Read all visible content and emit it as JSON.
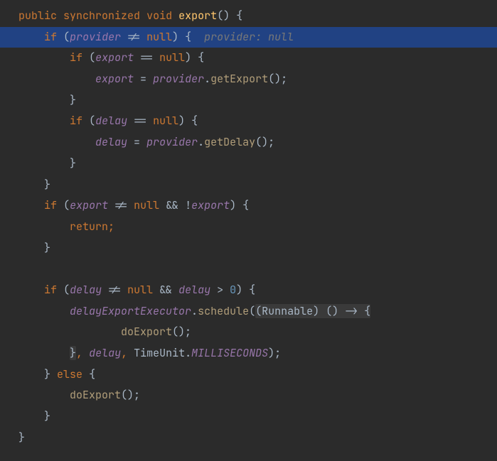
{
  "code": {
    "l1": {
      "kw1": "public",
      "kw2": "synchronized",
      "kw3": "void",
      "method": "export",
      "paren": "() {"
    },
    "l2": {
      "indent": "    ",
      "kw": "if",
      "p1": " (",
      "v": "provider",
      "op": " != ",
      "nul": "null",
      "p2": ") {  ",
      "hint": "provider: null"
    },
    "l3": {
      "indent": "        ",
      "kw": "if",
      "p1": " (",
      "v": "export",
      "op": " == ",
      "nul": "null",
      "p2": ") {"
    },
    "l4": {
      "indent": "            ",
      "v1": "export",
      "eq": " = ",
      "v2": "provider",
      "dot": ".",
      "m": "getExport",
      "p": "();"
    },
    "l5": {
      "indent": "        ",
      "b": "}"
    },
    "l6": {
      "indent": "        ",
      "kw": "if",
      "p1": " (",
      "v": "delay",
      "op": " == ",
      "nul": "null",
      "p2": ") {"
    },
    "l7": {
      "indent": "            ",
      "v1": "delay",
      "eq": " = ",
      "v2": "provider",
      "dot": ".",
      "m": "getDelay",
      "p": "();"
    },
    "l8": {
      "indent": "        ",
      "b": "}"
    },
    "l9": {
      "indent": "    ",
      "b": "}"
    },
    "l10": {
      "indent": "    ",
      "kw": "if",
      "p1": " (",
      "v1": "export",
      "op1": " != ",
      "nul": "null",
      "and": " && !",
      "v2": "export",
      "p2": ") {"
    },
    "l11": {
      "indent": "        ",
      "kw": "return",
      "semi": ";"
    },
    "l12": {
      "indent": "    ",
      "b": "}"
    },
    "l13": {
      "indent": ""
    },
    "l14": {
      "indent": "    ",
      "kw": "if",
      "p1": " (",
      "v1": "delay",
      "op1": " != ",
      "nul": "null",
      "and": " && ",
      "v2": "delay",
      "gt": " > ",
      "num": "0",
      "p2": ") {"
    },
    "l15": {
      "indent": "        ",
      "v": "delayExportExecutor",
      "dot": ".",
      "m": "schedule",
      "p1": "(",
      "cast": "(Runnable) () -> {"
    },
    "l16": {
      "indent": "                ",
      "m": "doExport",
      "p": "();"
    },
    "l17": {
      "indent": "        ",
      "b": "}",
      "comma": ", ",
      "v": "delay",
      "comma2": ", ",
      "type": "TimeUnit",
      "dot": ".",
      "c": "MILLISECONDS",
      "p": ");"
    },
    "l18": {
      "indent": "    ",
      "b1": "} ",
      "kw": "else",
      "b2": " {"
    },
    "l19": {
      "indent": "        ",
      "m": "doExport",
      "p": "();"
    },
    "l20": {
      "indent": "    ",
      "b": "}"
    },
    "l21": {
      "indent": "",
      "b": "}"
    }
  }
}
